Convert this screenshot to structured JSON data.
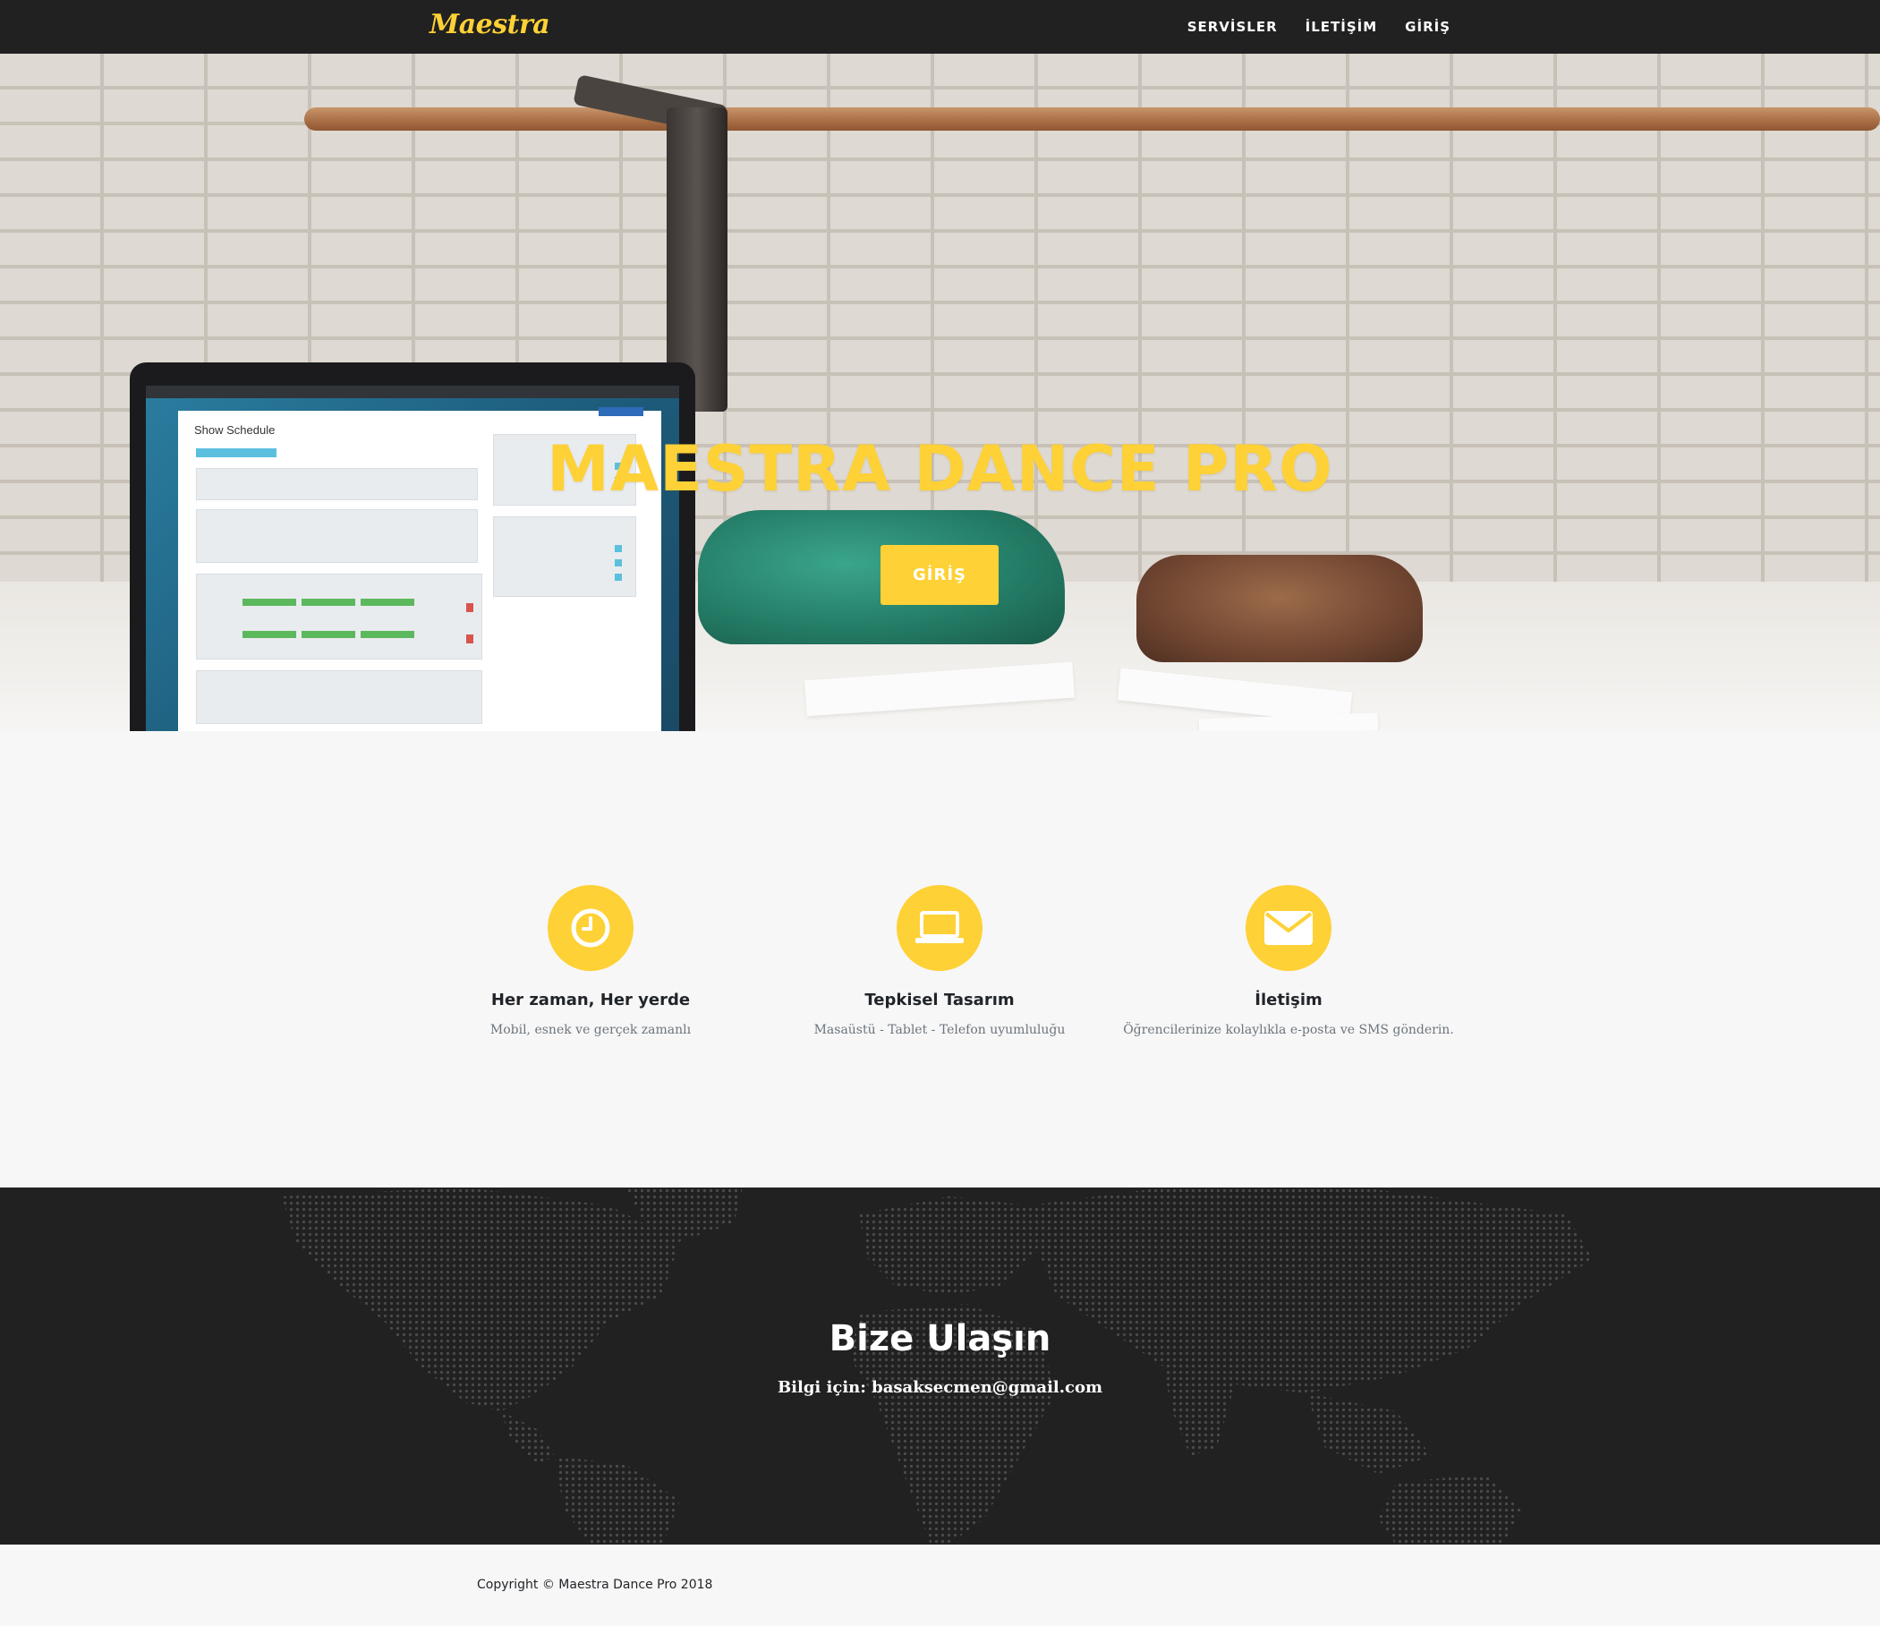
{
  "navbar": {
    "brand": "Maestra",
    "links": [
      {
        "label": "SERVİSLER"
      },
      {
        "label": "İLETİŞİM"
      },
      {
        "label": "GİRİŞ"
      }
    ]
  },
  "hero": {
    "title": "MAESTRA DANCE PRO",
    "button_label": "GİRİŞ",
    "laptop_screen": {
      "heading": "Show Schedule"
    }
  },
  "services": [
    {
      "icon": "clock-icon",
      "title": "Her zaman, Her yerde",
      "text": "Mobil, esnek ve gerçek zamanlı"
    },
    {
      "icon": "laptop-icon",
      "title": "Tepkisel Tasarım",
      "text": "Masaüstü - Tablet - Telefon uyumluluğu"
    },
    {
      "icon": "envelope-icon",
      "title": "İletişim",
      "text": "Öğrencilerinize kolaylıkla e-posta ve SMS gönderin."
    }
  ],
  "contact": {
    "title": "Bize Ulaşın",
    "subtitle": "Bilgi için: basaksecmen@gmail.com"
  },
  "footer": {
    "copyright": "Copyright © Maestra Dance Pro 2018"
  },
  "colors": {
    "accent": "#fed136",
    "dark": "#212121",
    "light_bg": "#f7f7f7"
  }
}
